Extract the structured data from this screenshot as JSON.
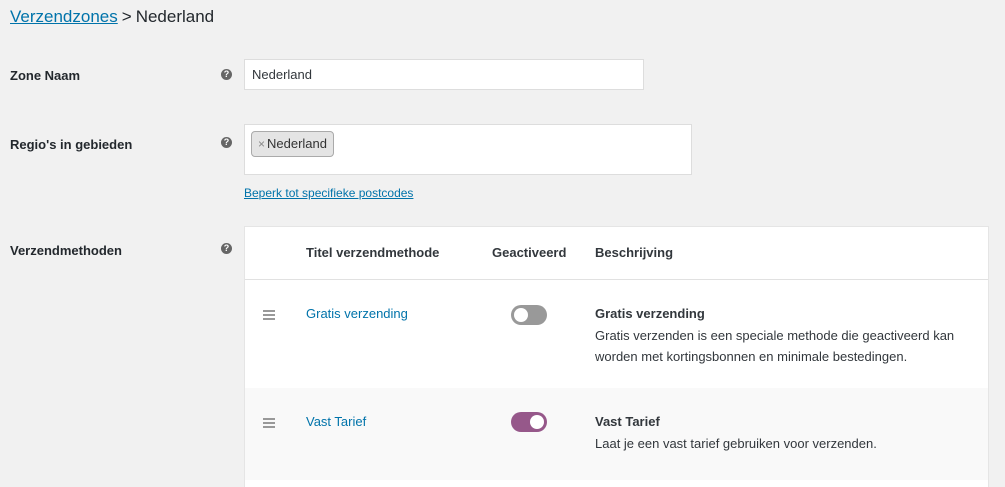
{
  "breadcrumb": {
    "parent": "Verzendzones",
    "separator": ">",
    "current": "Nederland"
  },
  "form": {
    "zone_name": {
      "label": "Zone Naam",
      "value": "Nederland"
    },
    "regions": {
      "label": "Regio's in gebieden",
      "tags": [
        "Nederland"
      ],
      "remove_glyph": "×",
      "postcode_link": "Beperk tot specifieke postcodes"
    },
    "methods_label": "Verzendmethoden",
    "help_glyph": "?"
  },
  "methods_table": {
    "headers": {
      "title": "Titel verzendmethode",
      "enabled": "Geactiveerd",
      "description": "Beschrijving"
    },
    "rows": [
      {
        "title": "Gratis verzending",
        "enabled": false,
        "desc_title": "Gratis verzending",
        "desc_text": "Gratis verzenden is een speciale methode die geactiveerd kan worden met kortingsbonnen en minimale bestedingen."
      },
      {
        "title": "Vast Tarief",
        "enabled": true,
        "desc_title": "Vast Tarief",
        "desc_text": "Laat je een vast tarief gebruiken voor verzenden."
      }
    ]
  },
  "colors": {
    "link": "#0073aa",
    "toggle_on": "#96588a",
    "toggle_off": "#999999"
  }
}
